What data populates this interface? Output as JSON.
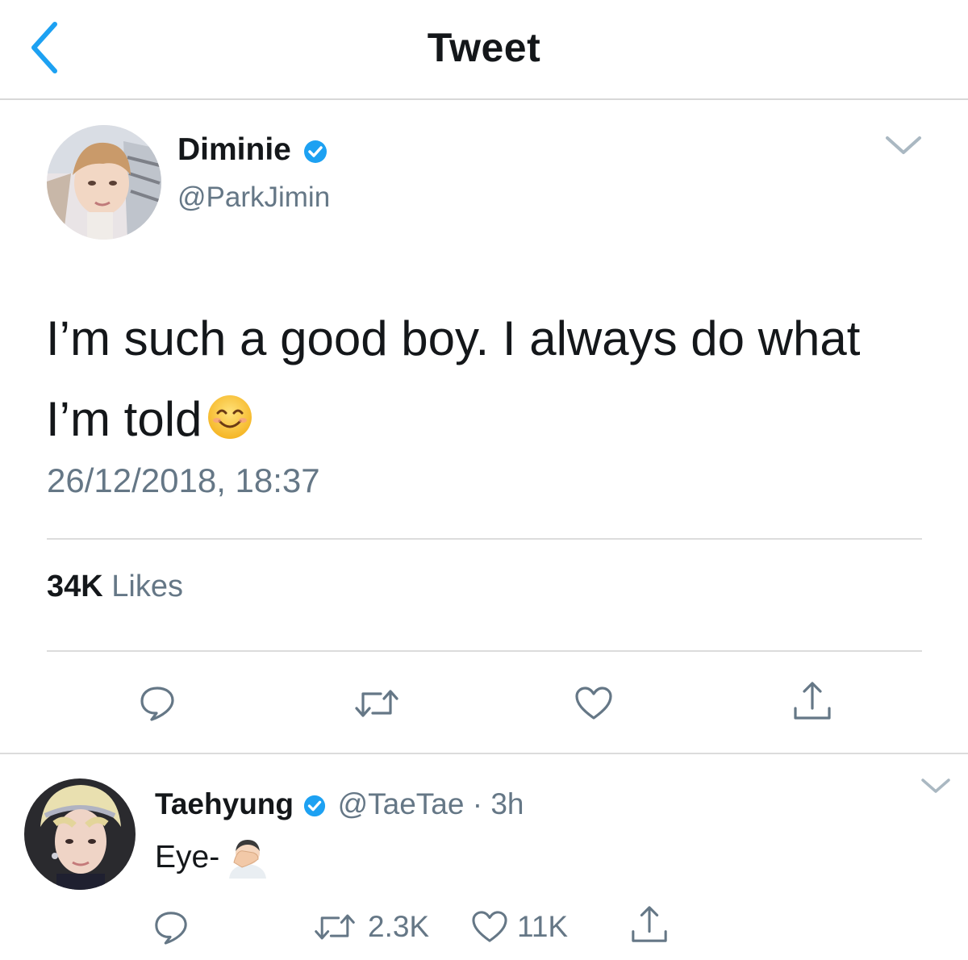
{
  "header": {
    "title": "Tweet"
  },
  "main_tweet": {
    "author_name": "Diminie",
    "author_handle": "@ParkJimin",
    "text_line1": "I’m such a good boy. I always do what",
    "text_line2": "I’m told",
    "emoji": "smiling-face-with-smiling-eyes",
    "timestamp": "26/12/2018, 18:37",
    "likes_count": "34K",
    "likes_label": "Likes",
    "actions": [
      "reply",
      "retweet",
      "like",
      "share"
    ]
  },
  "reply": {
    "author_name": "Taehyung",
    "author_handle": "@TaeTae",
    "separator": "·",
    "time": "3h",
    "text": "Eye-",
    "emoji": "man-facepalming",
    "retweet_count": "2.3K",
    "like_count": "11K"
  },
  "colors": {
    "accent": "#1da1f2",
    "text_primary": "#14171a",
    "text_secondary": "#657786",
    "divider": "#dcdcdc"
  }
}
